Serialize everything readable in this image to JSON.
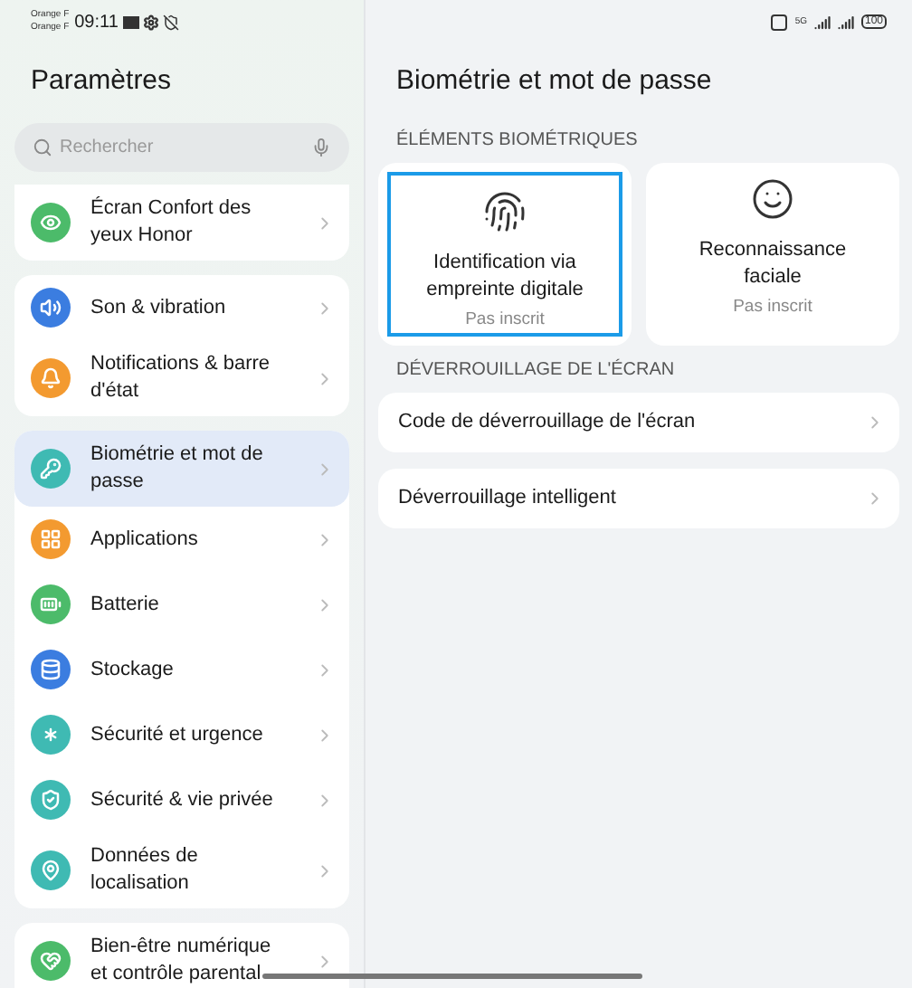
{
  "status_bar": {
    "carriers": [
      "Orange F",
      "Orange F"
    ],
    "time": "09:11",
    "network": "5G",
    "battery": "100"
  },
  "sidebar": {
    "title": "Paramètres",
    "search": {
      "placeholder": "Rechercher"
    },
    "groups": [
      {
        "items": [
          {
            "label": "Écran Confort des yeux Honor",
            "color": "#4cbb6a",
            "selected": false
          }
        ]
      },
      {
        "items": [
          {
            "label": "Son & vibration",
            "color": "#3b7de0",
            "selected": false
          },
          {
            "label": "Notifications & barre d'état",
            "color": "#f39a30",
            "selected": false
          }
        ]
      },
      {
        "items": [
          {
            "label": "Biométrie et mot de passe",
            "color": "#3fbab3",
            "selected": true
          },
          {
            "label": "Applications",
            "color": "#f39a30",
            "selected": false
          },
          {
            "label": "Batterie",
            "color": "#4cbb6a",
            "selected": false
          },
          {
            "label": "Stockage",
            "color": "#3b7de0",
            "selected": false
          },
          {
            "label": "Sécurité et urgence",
            "color": "#3fbab3",
            "selected": false
          },
          {
            "label": "Sécurité & vie privée",
            "color": "#3fbab3",
            "selected": false
          },
          {
            "label": "Données de localisation",
            "color": "#3fbab3",
            "selected": false
          }
        ]
      },
      {
        "items": [
          {
            "label": "Bien-être numérique et contrôle parental",
            "color": "#4cbb6a",
            "selected": false
          }
        ]
      }
    ]
  },
  "main": {
    "title": "Biométrie et mot de passe",
    "sections": [
      {
        "kind": "cards",
        "header": "ÉLÉMENTS BIOMÉTRIQUES",
        "items": [
          {
            "title": "Identification via empreinte digitale",
            "status": "Pas inscrit",
            "selected": true
          },
          {
            "title": "Reconnaissance faciale",
            "status": "Pas inscrit",
            "selected": false
          }
        ]
      },
      {
        "kind": "rows",
        "header": "DÉVERROUILLAGE DE L'ÉCRAN",
        "items": [
          {
            "label": "Code de déverrouillage de l'écran"
          },
          {
            "label": "Déverrouillage intelligent"
          }
        ]
      }
    ]
  }
}
